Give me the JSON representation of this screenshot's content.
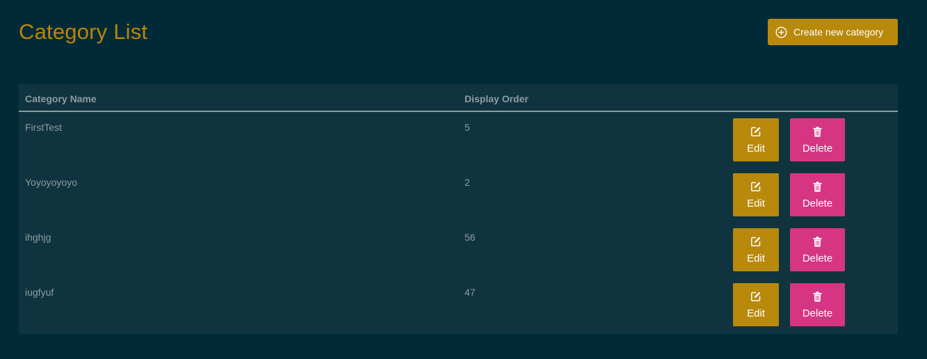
{
  "page": {
    "title": "Category List",
    "create_button_label": "Create new category"
  },
  "table": {
    "columns": [
      "Category Name",
      "Display Order"
    ],
    "rows": [
      {
        "name": "FirstTest",
        "order": "5"
      },
      {
        "name": "Yoyoyoyoyo",
        "order": "2"
      },
      {
        "name": "ihghjg",
        "order": "56"
      },
      {
        "name": "iugfyuf",
        "order": "47"
      }
    ],
    "edit_label": "Edit",
    "delete_label": "Delete"
  },
  "colors": {
    "background": "#012a38",
    "table_background": "#0f3440",
    "accent_gold": "#b8890b",
    "delete_pink": "#d63584",
    "text_muted": "#8d9ca1"
  },
  "icons": {
    "create": "plus-circle-icon",
    "edit": "edit-icon",
    "delete": "trash-icon"
  }
}
